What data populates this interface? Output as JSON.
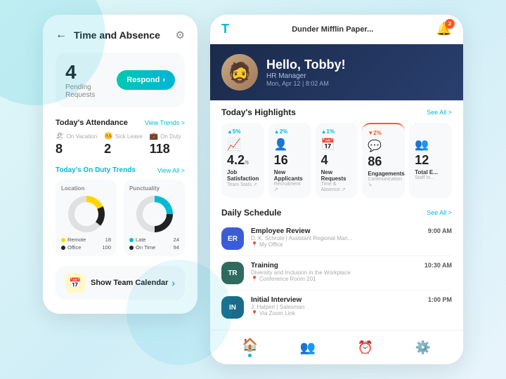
{
  "background": {
    "blob1": "blob",
    "blob2": "blob"
  },
  "left_panel": {
    "title": "Time and Absence",
    "pending": {
      "number": "4",
      "label": "Pending Requests",
      "respond_btn": "Respond"
    },
    "attendance": {
      "title": "Today's Attendance",
      "view_link": "View Trends >",
      "items": [
        {
          "icon": "🏖",
          "label": "On Vacation",
          "value": "8"
        },
        {
          "icon": "🤒",
          "label": "Sick Leave",
          "value": "2"
        },
        {
          "icon": "💼",
          "label": "On Duty",
          "value": "118"
        }
      ]
    },
    "trends": {
      "title": "Today's On Duty Trends",
      "view_link": "View All >",
      "location": {
        "title": "Location",
        "legend": [
          {
            "label": "Remote",
            "value": "18",
            "color": "#ffd600"
          },
          {
            "label": "Office",
            "value": "100",
            "color": "#222"
          }
        ]
      },
      "punctuality": {
        "title": "Punctuality",
        "legend": [
          {
            "label": "Late",
            "value": "24",
            "color": "#00bcd4"
          },
          {
            "label": "On Time",
            "value": "94",
            "color": "#222"
          }
        ]
      }
    },
    "calendar_btn": "Show Team Calendar"
  },
  "right_panel": {
    "top_bar": {
      "logo": "T",
      "company": "Dunder Mifflin Paper...",
      "notif_count": "2"
    },
    "hero": {
      "greeting": "Hello, Tobby!",
      "role": "HR Manager",
      "datetime": "Mon, Apr 12 | 8:02 AM"
    },
    "highlights": {
      "title": "Today's Highlights",
      "see_all": "See All >",
      "cards": [
        {
          "badge": "+5%",
          "positive": true,
          "value": "4.2",
          "sub": "/5",
          "label": "Job Satisfaction",
          "category": "Team Stats ↗",
          "icon": "📈"
        },
        {
          "badge": "+2%",
          "positive": true,
          "value": "16",
          "sub": "",
          "label": "New Applicants",
          "category": "Recruitment ↗",
          "icon": "👤"
        },
        {
          "badge": "+1%",
          "positive": true,
          "value": "4",
          "sub": "",
          "label": "New Requests",
          "category": "Time & Absence ↗",
          "icon": "📅"
        },
        {
          "badge": "▼2%",
          "positive": false,
          "value": "86",
          "sub": "",
          "label": "Engagements",
          "category": "Communication ↘",
          "icon": "💬"
        },
        {
          "badge": "",
          "positive": true,
          "value": "12",
          "sub": "",
          "label": "Total E...",
          "category": "Staff In...",
          "icon": "👥"
        }
      ]
    },
    "schedule": {
      "title": "Daily Schedule",
      "see_all": "See All >",
      "items": [
        {
          "initials": "ER",
          "color": "#3b5bdb",
          "title": "Employee Review",
          "sub": "D. K. Schrute | Assistant Regional Man...",
          "location": "My Office",
          "time": "9:00 AM"
        },
        {
          "initials": "TR",
          "color": "#2e6b5e",
          "title": "Training",
          "sub": "Diversity and Inclusion in the Workplace",
          "location": "Conference Room 201",
          "time": "10:30 AM"
        },
        {
          "initials": "IN",
          "color": "#1a6b8a",
          "title": "Initial Interview",
          "sub": "J. Halpert | Salesman",
          "location": "Via Zoom Link",
          "time": "1:00 PM"
        }
      ]
    },
    "nav": {
      "items": [
        {
          "icon": "🏠",
          "active": true
        },
        {
          "icon": "👥",
          "active": false
        },
        {
          "icon": "⏰",
          "active": false
        },
        {
          "icon": "⚙️",
          "active": false
        }
      ]
    }
  }
}
